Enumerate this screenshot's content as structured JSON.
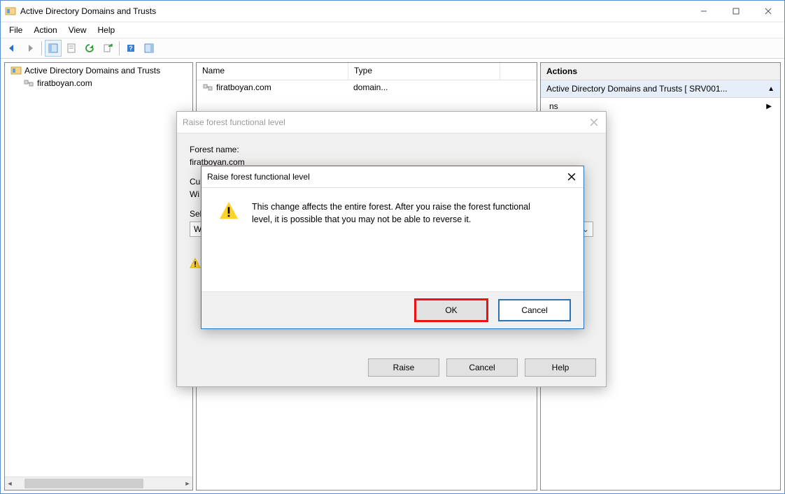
{
  "window": {
    "title": "Active Directory Domains and Trusts"
  },
  "menu": {
    "file": "File",
    "action": "Action",
    "view": "View",
    "help": "Help"
  },
  "tree": {
    "root": "Active Directory Domains and Trusts",
    "node": "firatboyan.com"
  },
  "list": {
    "header_name": "Name",
    "header_type": "Type",
    "row_name": "firatboyan.com",
    "row_type": "domain..."
  },
  "actions": {
    "title": "Actions",
    "sel": "Active Directory Domains and Trusts [ SRV001...",
    "more": "ns",
    "more_suffix": "More Actions"
  },
  "dlg1": {
    "title": "Raise forest functional level",
    "forest_lbl": "Forest name:",
    "forest_val": "firatboyan.com",
    "current_lbl": "Cur",
    "current_val": "Wi",
    "select_lbl": "Sel",
    "select_val": "Wi",
    "raise": "Raise",
    "cancel": "Cancel",
    "help": "Help"
  },
  "dlg2": {
    "title": "Raise forest functional level",
    "msg": "This change affects the entire forest. After you raise the forest functional level, it is possible that you may not be able to reverse it.",
    "ok": "OK",
    "cancel": "Cancel"
  }
}
